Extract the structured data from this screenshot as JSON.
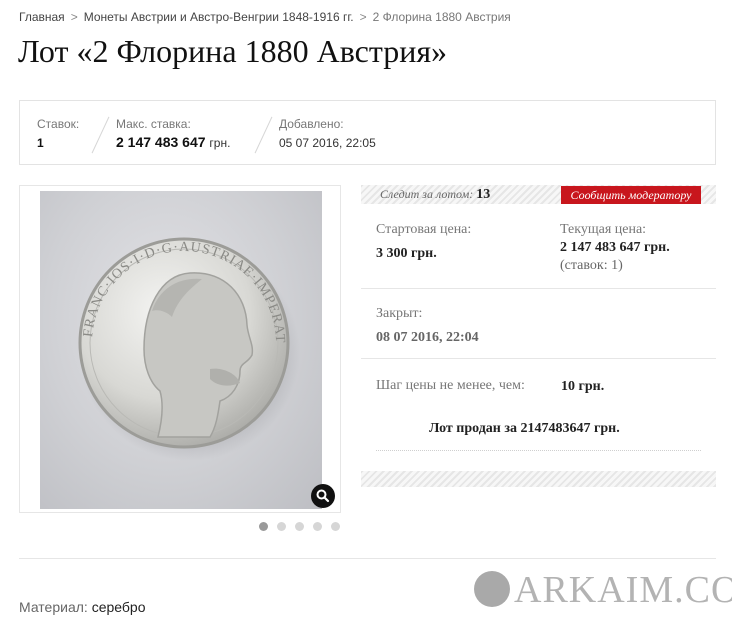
{
  "breadcrumb": {
    "items": [
      "Главная",
      "Монеты Австрии и Австро-Венгрии 1848-1916 гг."
    ],
    "current": "2 Флорина 1880 Австрия",
    "separator": ">"
  },
  "page_title": "Лот «2 Флорина 1880 Австрия»",
  "stats": {
    "bids_label": "Ставок:",
    "bids_value": "1",
    "max_bid_label": "Макс. ставка:",
    "max_bid_value": "2 147 483 647",
    "max_bid_unit": "грн.",
    "added_label": "Добавлено:",
    "added_value": "05 07 2016, 22:05"
  },
  "gallery": {
    "coin_legend": "FRANC·IOS·I·D·G·AUSTRIAE·IMPERATOR",
    "zoom_icon": "magnifier-icon",
    "slide_count": 5,
    "active_slide": 1
  },
  "watch": {
    "label": "Следит за лотом:",
    "count": "13",
    "report_label": "Сообщить модератору"
  },
  "prices": {
    "start_label": "Стартовая цена:",
    "start_value": "3 300 грн.",
    "current_label": "Текущая цена:",
    "current_value": "2 147 483 647 грн.",
    "current_bids": "(ставок: 1)"
  },
  "closed": {
    "label": "Закрыт:",
    "value": "08 07 2016, 22:04"
  },
  "step": {
    "label": "Шаг цены не менее, чем:",
    "value": "10 грн."
  },
  "sold_text": "Лот продан за 2147483647 грн.",
  "material": {
    "label": "Материал:",
    "value": "серебро"
  },
  "watermark": "ARKAIM.CO",
  "colors": {
    "accent_red": "#c8161d",
    "text_dark": "#222222",
    "text_muted": "#777777"
  }
}
